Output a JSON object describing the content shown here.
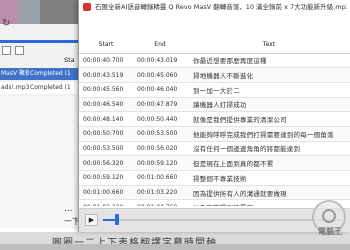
{
  "background": {
    "column_header": "Sta",
    "rows": [
      {
        "file": "MasV 聚餐",
        "status": "Completed (1"
      },
      {
        "file": "ads!.mp3",
        "status": "Completed (1"
      }
    ],
    "ellipsis": "...",
    "dash": "一下",
    "bottom_caption": "圓圈一二上下表格翻譯字幕時間軸"
  },
  "window": {
    "title": "石匯全新AI語音轉錄精靈 Q Revo MasV 翻轉音落，10 滿全錄前 x 7大功能新升級.mp3",
    "columns": {
      "start": "Start",
      "end": "End",
      "text": "Text"
    },
    "rows": [
      {
        "start": "00:00:40.700",
        "end": "00:00:43.019",
        "text": "你最近想要那麼再度這種"
      },
      {
        "start": "00:00:43.519",
        "end": "00:00:45.060",
        "text": "掃地機器人不斷進化"
      },
      {
        "start": "00:00:45.560",
        "end": "00:00:46.040",
        "text": "到一加一大於二"
      },
      {
        "start": "00:00:46.540",
        "end": "00:00:47.879",
        "text": "讓機器人打掃成功"
      },
      {
        "start": "00:00:48.140",
        "end": "00:00:50.440",
        "text": "就像是我們提供專業的清潔公司"
      },
      {
        "start": "00:00:50.700",
        "end": "00:00:53.500",
        "text": "他能夠呼呼完成我們打掃需要達到的每一個角落"
      },
      {
        "start": "00:00:53.500",
        "end": "00:00:56.020",
        "text": "沒有任何一個邊邊角角的將都能達到"
      },
      {
        "start": "00:00:56.320",
        "end": "00:00:59.120",
        "text": "但是現在上面到真的都不累"
      },
      {
        "start": "00:00:59.120",
        "end": "00:01:00.660",
        "text": "掃整個不專業技術"
      },
      {
        "start": "00:01:00.660",
        "end": "00:01:03.220",
        "text": "因為提供所有人的溝通就要做現"
      },
      {
        "start": "00:01:03.220",
        "end": "00:01:04.760",
        "text": "以及實施提到的厚實"
      },
      {
        "start": "00:01:04.760",
        "end": "00:01:05.780",
        "text": "也不需要花了"
      }
    ],
    "player": {
      "play_symbol": "▶",
      "progress": 0.06
    }
  },
  "watermark": {
    "text": "電腦王"
  },
  "colors": {
    "accent": "#2d6bd6",
    "app_icon": "#d7322b",
    "selection": "#3f73c9"
  }
}
